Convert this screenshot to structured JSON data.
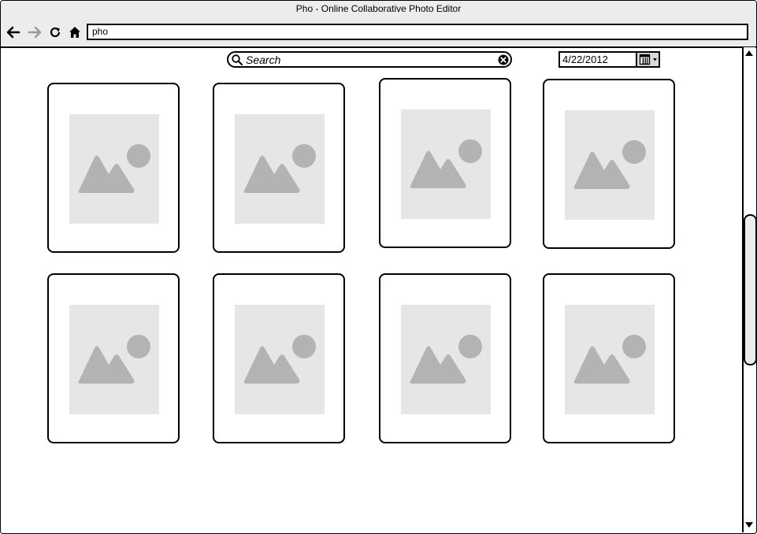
{
  "browser": {
    "title": "Pho - Online Collaborative Photo Editor",
    "address": "pho",
    "icons": [
      "back-arrow-icon",
      "forward-arrow-icon",
      "reload-icon",
      "home-icon"
    ]
  },
  "search": {
    "placeholder": "Search",
    "icons": [
      "search-icon",
      "clear-icon"
    ]
  },
  "date_picker": {
    "value": "4/22/2012",
    "icon": "calendar-icon"
  },
  "gallery": {
    "rows": 2,
    "columns": 4,
    "thumbnail_icon": "image-placeholder-icon"
  },
  "colors": {
    "chrome": "#ececec",
    "placeholder_bg": "#e6e6e6",
    "placeholder_fg": "#b3b3b3",
    "border": "#000000"
  }
}
